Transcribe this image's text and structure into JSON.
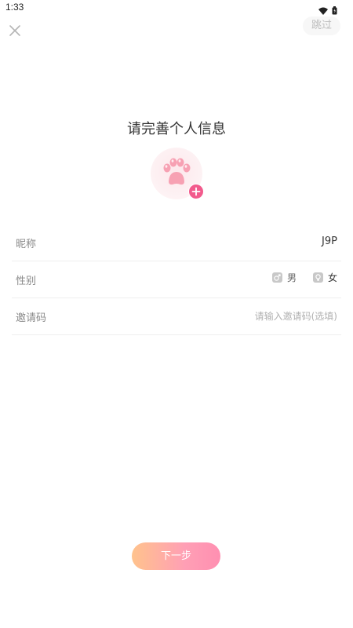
{
  "status_bar": {
    "time": "1:33"
  },
  "header": {
    "skip_label": "跳过"
  },
  "page": {
    "title": "请完善个人信息"
  },
  "form": {
    "nickname": {
      "label": "昵称",
      "value": "J9P"
    },
    "gender": {
      "label": "性别",
      "options": [
        "男",
        "女"
      ]
    },
    "invite": {
      "label": "邀请码",
      "placeholder": "请输入邀请码(选填)"
    }
  },
  "footer": {
    "next_label": "下一步"
  },
  "colors": {
    "accent_pink": "#f25a8c",
    "button_gradient_start": "#ffc38c",
    "button_gradient_end": "#ff8fb1"
  }
}
